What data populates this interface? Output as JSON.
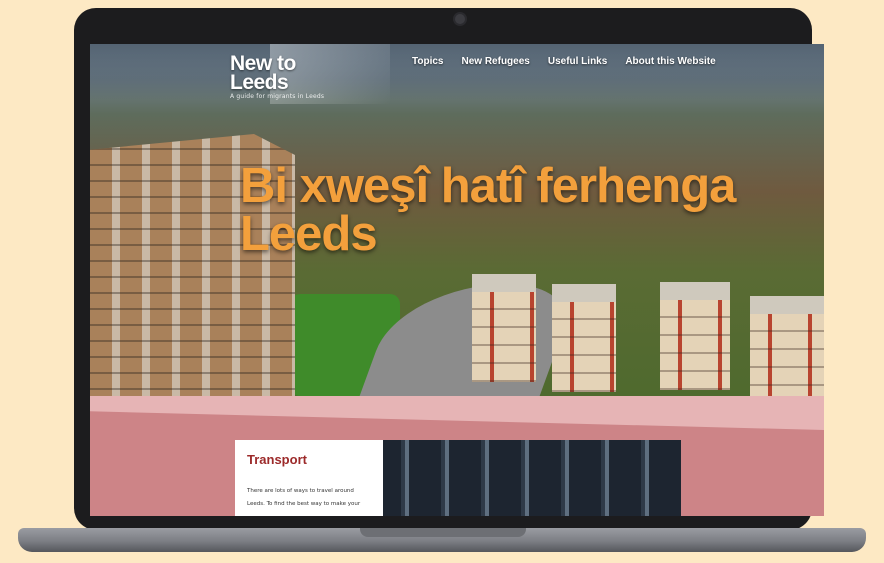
{
  "site": {
    "logo": "New to Leeds",
    "tagline": "A guide for migrants in Leeds"
  },
  "nav": {
    "items": [
      "Topics",
      "New Refugees",
      "Useful Links",
      "About this Website"
    ]
  },
  "hero": {
    "title": "Bi xweşî hatî ferhenga Leeds"
  },
  "card": {
    "title": "Transport",
    "body_line1": "There are lots of ways to travel around",
    "body_line2": "Leeds. To find the best way to make your"
  },
  "colors": {
    "accent_orange": "#f3a03c",
    "section_pink": "#cd8487",
    "card_title_red": "#9c2a2a",
    "page_background": "#fde9c4"
  }
}
